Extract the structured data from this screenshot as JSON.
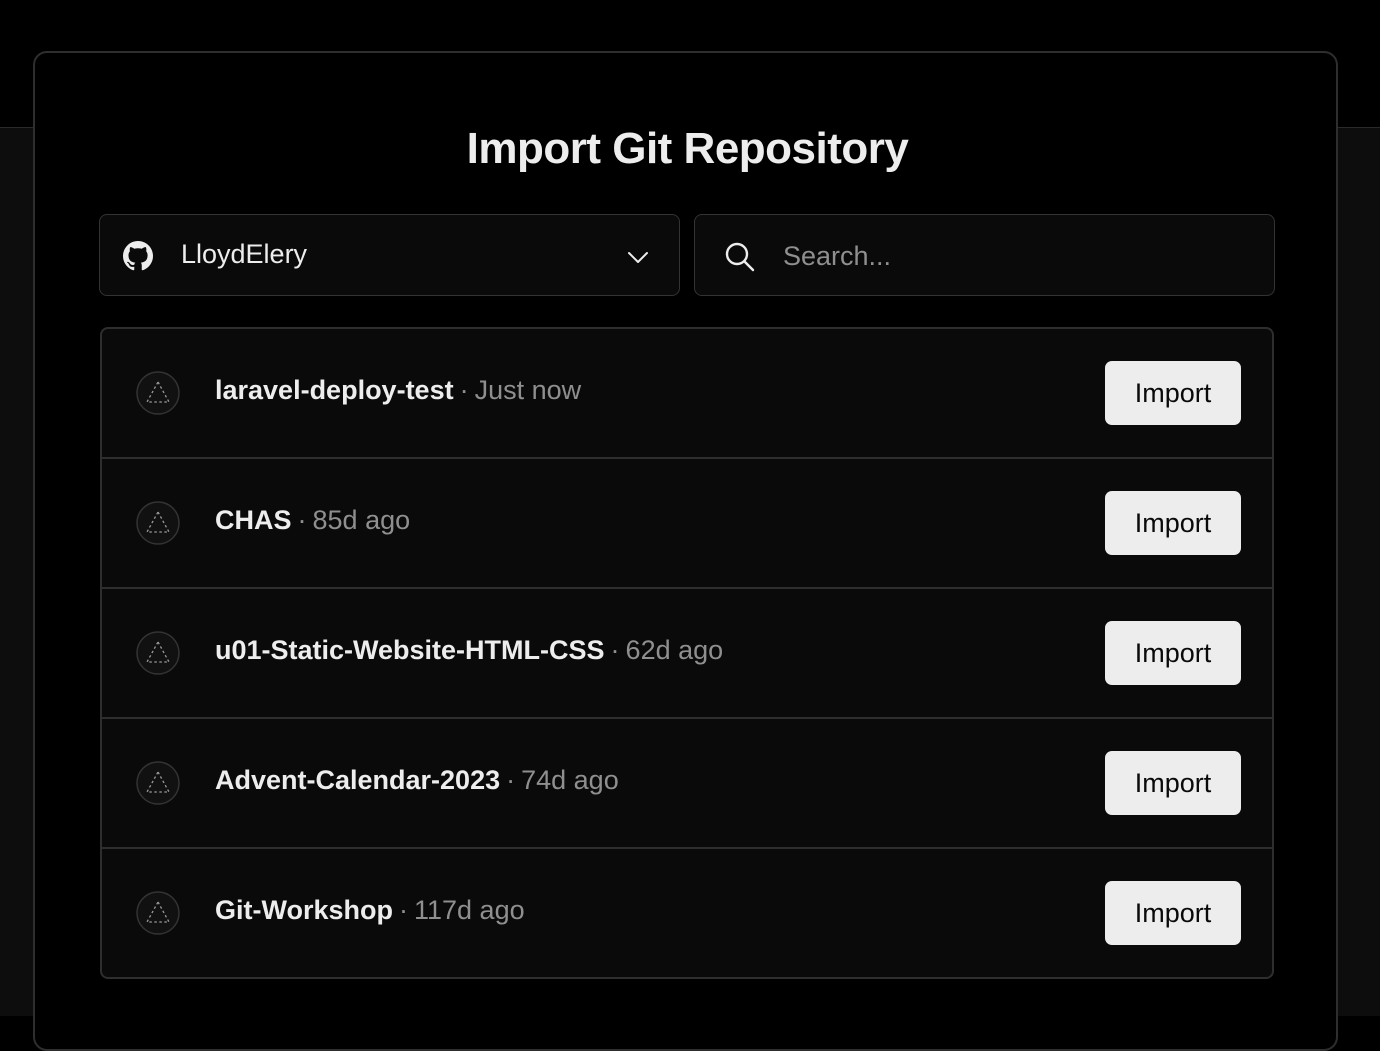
{
  "page": {
    "title": "Import Git Repository"
  },
  "scope_selector": {
    "account": "LloydElery",
    "provider_icon": "github-icon",
    "expand_icon": "chevron-down-icon"
  },
  "search": {
    "placeholder": "Search...",
    "value": "",
    "icon": "search-icon"
  },
  "repositories": [
    {
      "name": "laravel-deploy-test",
      "separator": "·",
      "updated": "Just now",
      "action": "Import"
    },
    {
      "name": "CHAS",
      "separator": "·",
      "updated": "85d ago",
      "action": "Import"
    },
    {
      "name": "u01-Static-Website-HTML-CSS",
      "separator": "·",
      "updated": "62d ago",
      "action": "Import"
    },
    {
      "name": "Advent-Calendar-2023",
      "separator": "·",
      "updated": "74d ago",
      "action": "Import"
    },
    {
      "name": "Git-Workshop",
      "separator": "·",
      "updated": "117d ago",
      "action": "Import"
    }
  ],
  "colors": {
    "background": "#000000",
    "surface": "#0a0a0a",
    "border": "#2e2e2e",
    "text_primary": "#ededed",
    "text_secondary": "#8f8f8f",
    "button_bg": "#ededed",
    "button_text": "#0a0a0a"
  }
}
